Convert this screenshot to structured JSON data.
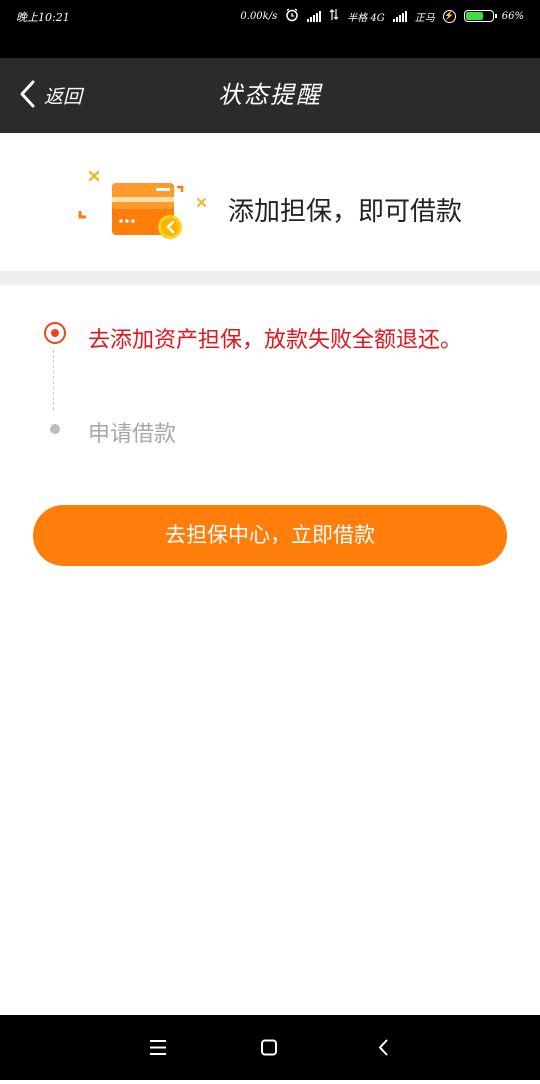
{
  "status_bar": {
    "time": "晚上10:21",
    "speed": "0.00k/s",
    "carrier1": "半格 4G",
    "carrier2": "正马",
    "battery": "66%",
    "battery_level": 0.66
  },
  "header": {
    "back_label": "返回",
    "title": "状态提醒"
  },
  "banner": {
    "text": "添加担保，即可借款"
  },
  "steps": [
    {
      "label": "去添加资产担保，放款失败全额退还。",
      "active": true
    },
    {
      "label": "申请借款",
      "active": false
    }
  ],
  "cta": {
    "label": "去担保中心，立即借款"
  },
  "colors": {
    "accent": "#ff7d0b",
    "active_step": "#e4141c",
    "header_bg": "#2b2b2b"
  },
  "nav": {
    "icons": [
      "menu-icon",
      "home-square-icon",
      "back-chevron-icon"
    ]
  }
}
